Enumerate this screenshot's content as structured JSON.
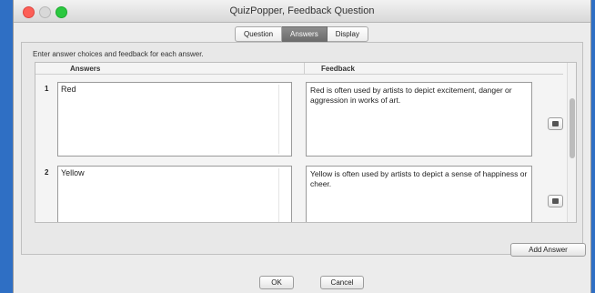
{
  "window": {
    "title": "QuizPopper, Feedback Question"
  },
  "tabs": [
    {
      "label": "Question",
      "active": false
    },
    {
      "label": "Answers",
      "active": true
    },
    {
      "label": "Display",
      "active": false
    }
  ],
  "instruction": "Enter answer choices and feedback for each answer.",
  "table": {
    "headers": {
      "answers": "Answers",
      "feedback": "Feedback"
    },
    "rows": [
      {
        "number": "1",
        "answer": "Red",
        "feedback": "Red is often used by artists to depict excitement, danger or aggression in works of art."
      },
      {
        "number": "2",
        "answer": "Yellow",
        "feedback": "Yellow is often used by artists to depict a sense of happiness or cheer."
      }
    ]
  },
  "buttons": {
    "add_answer": "Add Answer",
    "ok": "OK",
    "cancel": "Cancel"
  },
  "icons": {
    "delete": "trash-icon"
  }
}
